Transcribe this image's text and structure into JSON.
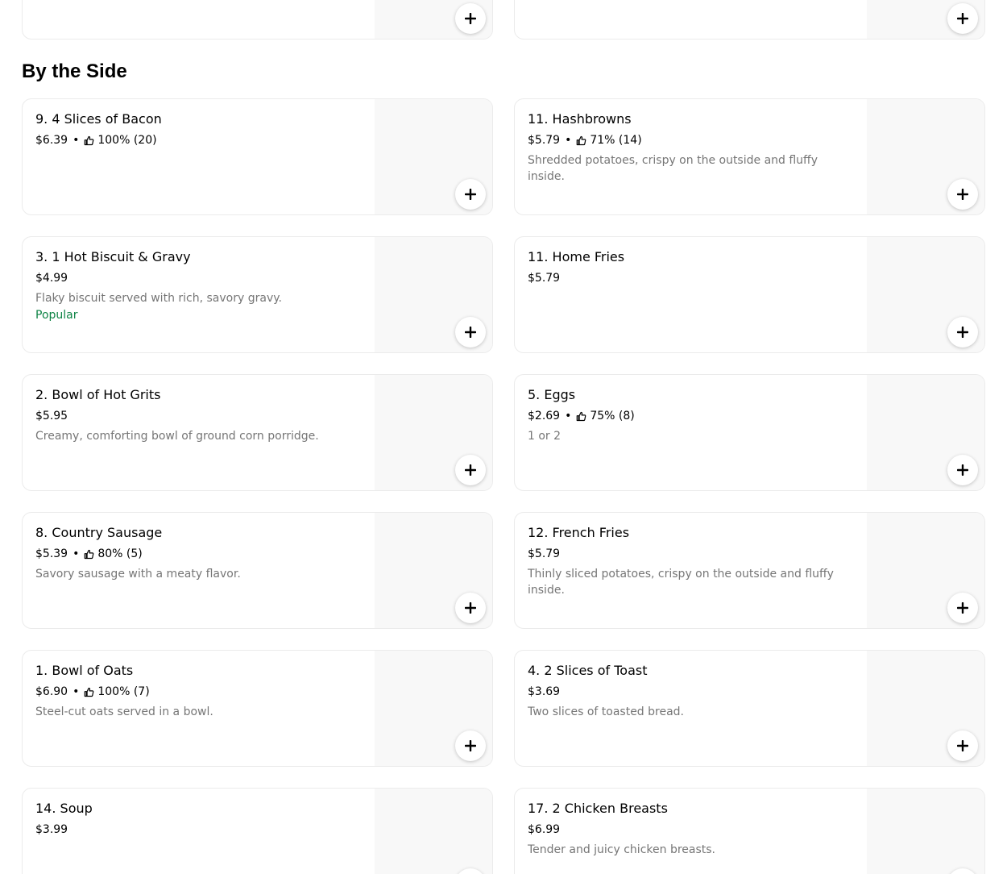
{
  "section": {
    "title": "By the Side"
  },
  "icons": {
    "add": "plus-icon",
    "rating": "thumbs-up-icon"
  },
  "colors": {
    "popular": "#0e8345",
    "description": "#767676",
    "image_placeholder": "#f8f8f8"
  },
  "items": [
    {
      "title": "9. 4 Slices of Bacon",
      "price": "$6.39",
      "rating": "100% (20)",
      "description": "",
      "badge": ""
    },
    {
      "title": "11. Hashbrowns",
      "price": "$5.79",
      "rating": "71% (14)",
      "description": "Shredded potatoes, crispy on the outside and fluffy inside.",
      "badge": ""
    },
    {
      "title": "3. 1 Hot Biscuit & Gravy",
      "price": "$4.99",
      "rating": "",
      "description": "Flaky biscuit served with rich, savory gravy.",
      "badge": "Popular"
    },
    {
      "title": "11. Home Fries",
      "price": "$5.79",
      "rating": "",
      "description": "",
      "badge": ""
    },
    {
      "title": "2. Bowl of Hot Grits",
      "price": "$5.95",
      "rating": "",
      "description": "Creamy, comforting bowl of ground corn porridge.",
      "badge": ""
    },
    {
      "title": "5. Eggs",
      "price": "$2.69",
      "rating": "75% (8)",
      "description": "1 or 2",
      "badge": ""
    },
    {
      "title": "8. Country Sausage",
      "price": "$5.39",
      "rating": "80% (5)",
      "description": "Savory sausage with a meaty flavor.",
      "badge": ""
    },
    {
      "title": "12. French Fries",
      "price": "$5.79",
      "rating": "",
      "description": "Thinly sliced potatoes, crispy on the outside and fluffy inside.",
      "badge": ""
    },
    {
      "title": "1. Bowl of Oats",
      "price": "$6.90",
      "rating": "100% (7)",
      "description": "Steel-cut oats served in a bowl.",
      "badge": ""
    },
    {
      "title": "4. 2 Slices of Toast",
      "price": "$3.69",
      "rating": "",
      "description": "Two slices of toasted bread.",
      "badge": ""
    },
    {
      "title": "14. Soup",
      "price": "$3.99",
      "rating": "",
      "description": "",
      "badge": ""
    },
    {
      "title": "17. 2 Chicken Breasts",
      "price": "$6.99",
      "rating": "",
      "description": "Tender and juicy chicken breasts.",
      "badge": ""
    }
  ]
}
